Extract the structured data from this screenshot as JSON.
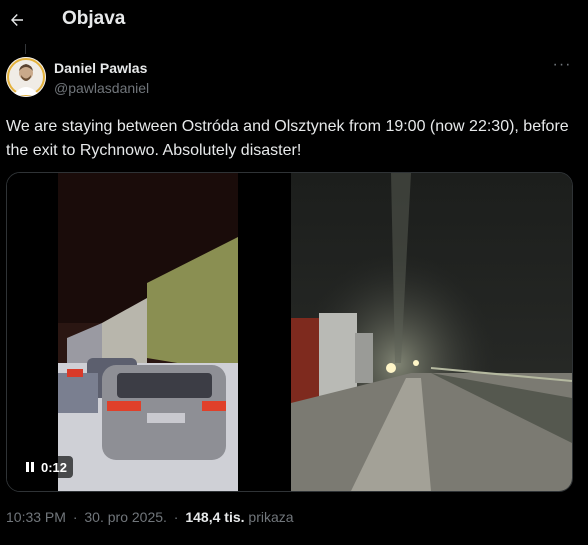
{
  "header": {
    "title": "Objava",
    "back_icon": "arrow-left-icon"
  },
  "author": {
    "name": "Daniel Pawlas",
    "handle": "@pawlasdaniel"
  },
  "post": {
    "text": "We are staying between Ostróda and Olsztynek from 19:00 (now 22:30), before the exit to Rychnowo. Absolutely disaster!"
  },
  "media": {
    "video_time": "0:12",
    "video_icon": "pause-icon"
  },
  "meta": {
    "time": "10:33 PM",
    "separator": "·",
    "date": "30. pro 2025.",
    "views": "148,4 tis.",
    "views_label": "prikaza"
  },
  "colors": {
    "background": "#000000",
    "text": "#e7e9ea",
    "secondary": "#71767b",
    "border": "#2f3336"
  }
}
